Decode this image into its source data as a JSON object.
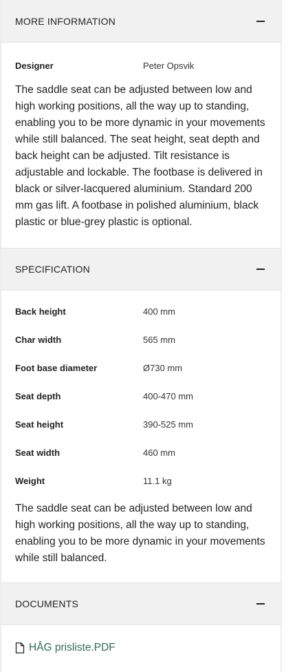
{
  "sections": {
    "more_info": {
      "title": "MORE INFORMATION",
      "rows": [
        {
          "label": "Designer",
          "value": "Peter Opsvik"
        }
      ],
      "description": "The saddle seat can be adjusted between low and high working positions, all the way up to standing, enabling you to be more dynamic in your movements while still balanced. The seat height, seat depth and back height can be adjusted. Tilt resistance is adjustable and lockable. The footbase is delivered in black or silver-lacquered aluminium. Standard 200 mm gas lift. A footbase in polished aluminium, black plastic or blue-grey plastic is optional."
    },
    "specification": {
      "title": "SPECIFICATION",
      "rows": [
        {
          "label": "Back height",
          "value": "400 mm"
        },
        {
          "label": "Char width",
          "value": "565 mm"
        },
        {
          "label": "Foot base diameter",
          "value": "Ø730 mm"
        },
        {
          "label": "Seat depth",
          "value": "400-470 mm"
        },
        {
          "label": "Seat height",
          "value": "390-525 mm"
        },
        {
          "label": "Seat width",
          "value": "460 mm"
        },
        {
          "label": "Weight",
          "value": "11.1 kg"
        }
      ],
      "description": "The saddle seat can be adjusted between low and high working positions, all the way up to standing, enabling you to be more dynamic in your movements while still balanced."
    },
    "documents": {
      "title": "DOCUMENTS",
      "files": [
        {
          "name": "HÅG prisliste.PDF",
          "icon": "file-icon"
        }
      ]
    }
  },
  "colors": {
    "header_bg": "#f1f1f1",
    "link": "#2f6b57",
    "text": "#222222"
  }
}
